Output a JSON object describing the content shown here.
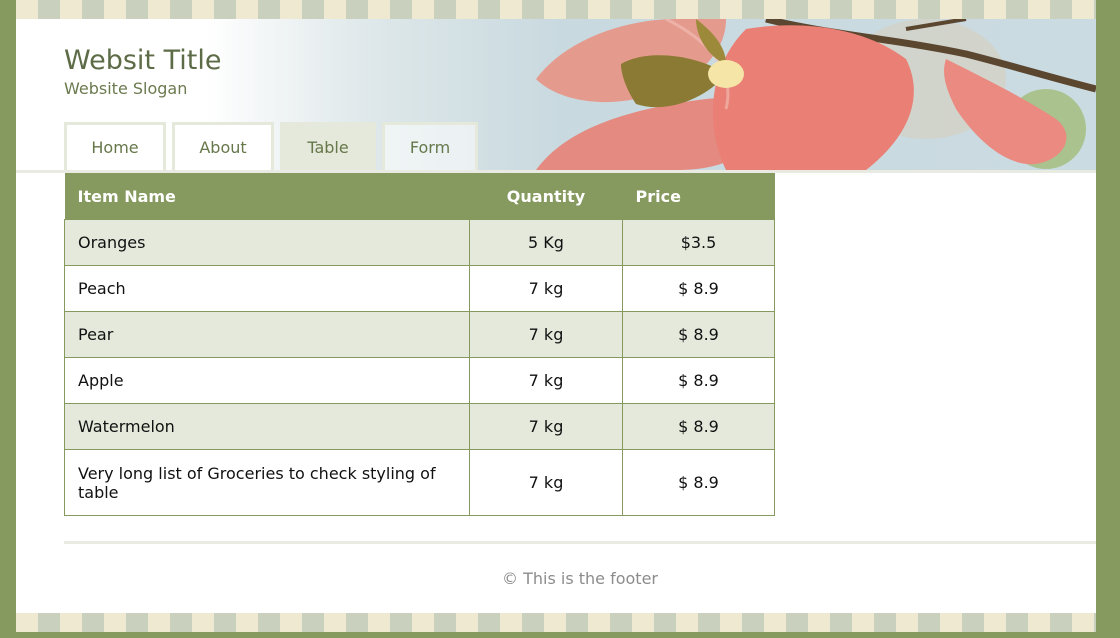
{
  "site": {
    "title": "Websit Title",
    "slogan": "Website Slogan"
  },
  "nav": {
    "items": [
      {
        "label": "Home",
        "active": false
      },
      {
        "label": "About",
        "active": false
      },
      {
        "label": "Table",
        "active": true
      },
      {
        "label": "Form",
        "active": false
      }
    ]
  },
  "table": {
    "headers": [
      "Item Name",
      "Quantity",
      "Price"
    ],
    "rows": [
      {
        "name": "Oranges",
        "quantity": "5 Kg",
        "price": "$3.5"
      },
      {
        "name": "Peach",
        "quantity": "7 kg",
        "price": "$ 8.9"
      },
      {
        "name": "Pear",
        "quantity": "7 kg",
        "price": "$ 8.9"
      },
      {
        "name": "Apple",
        "quantity": "7 kg",
        "price": "$ 8.9"
      },
      {
        "name": "Watermelon",
        "quantity": "7 kg",
        "price": "$ 8.9"
      },
      {
        "name": "Very long list of Groceries to check styling of table",
        "quantity": "7 kg",
        "price": "$ 8.9"
      }
    ]
  },
  "footer": {
    "text": "© This is the footer"
  },
  "colors": {
    "accent": "#86995f",
    "row_alt": "#e5e9dc",
    "title": "#5d6b46"
  }
}
